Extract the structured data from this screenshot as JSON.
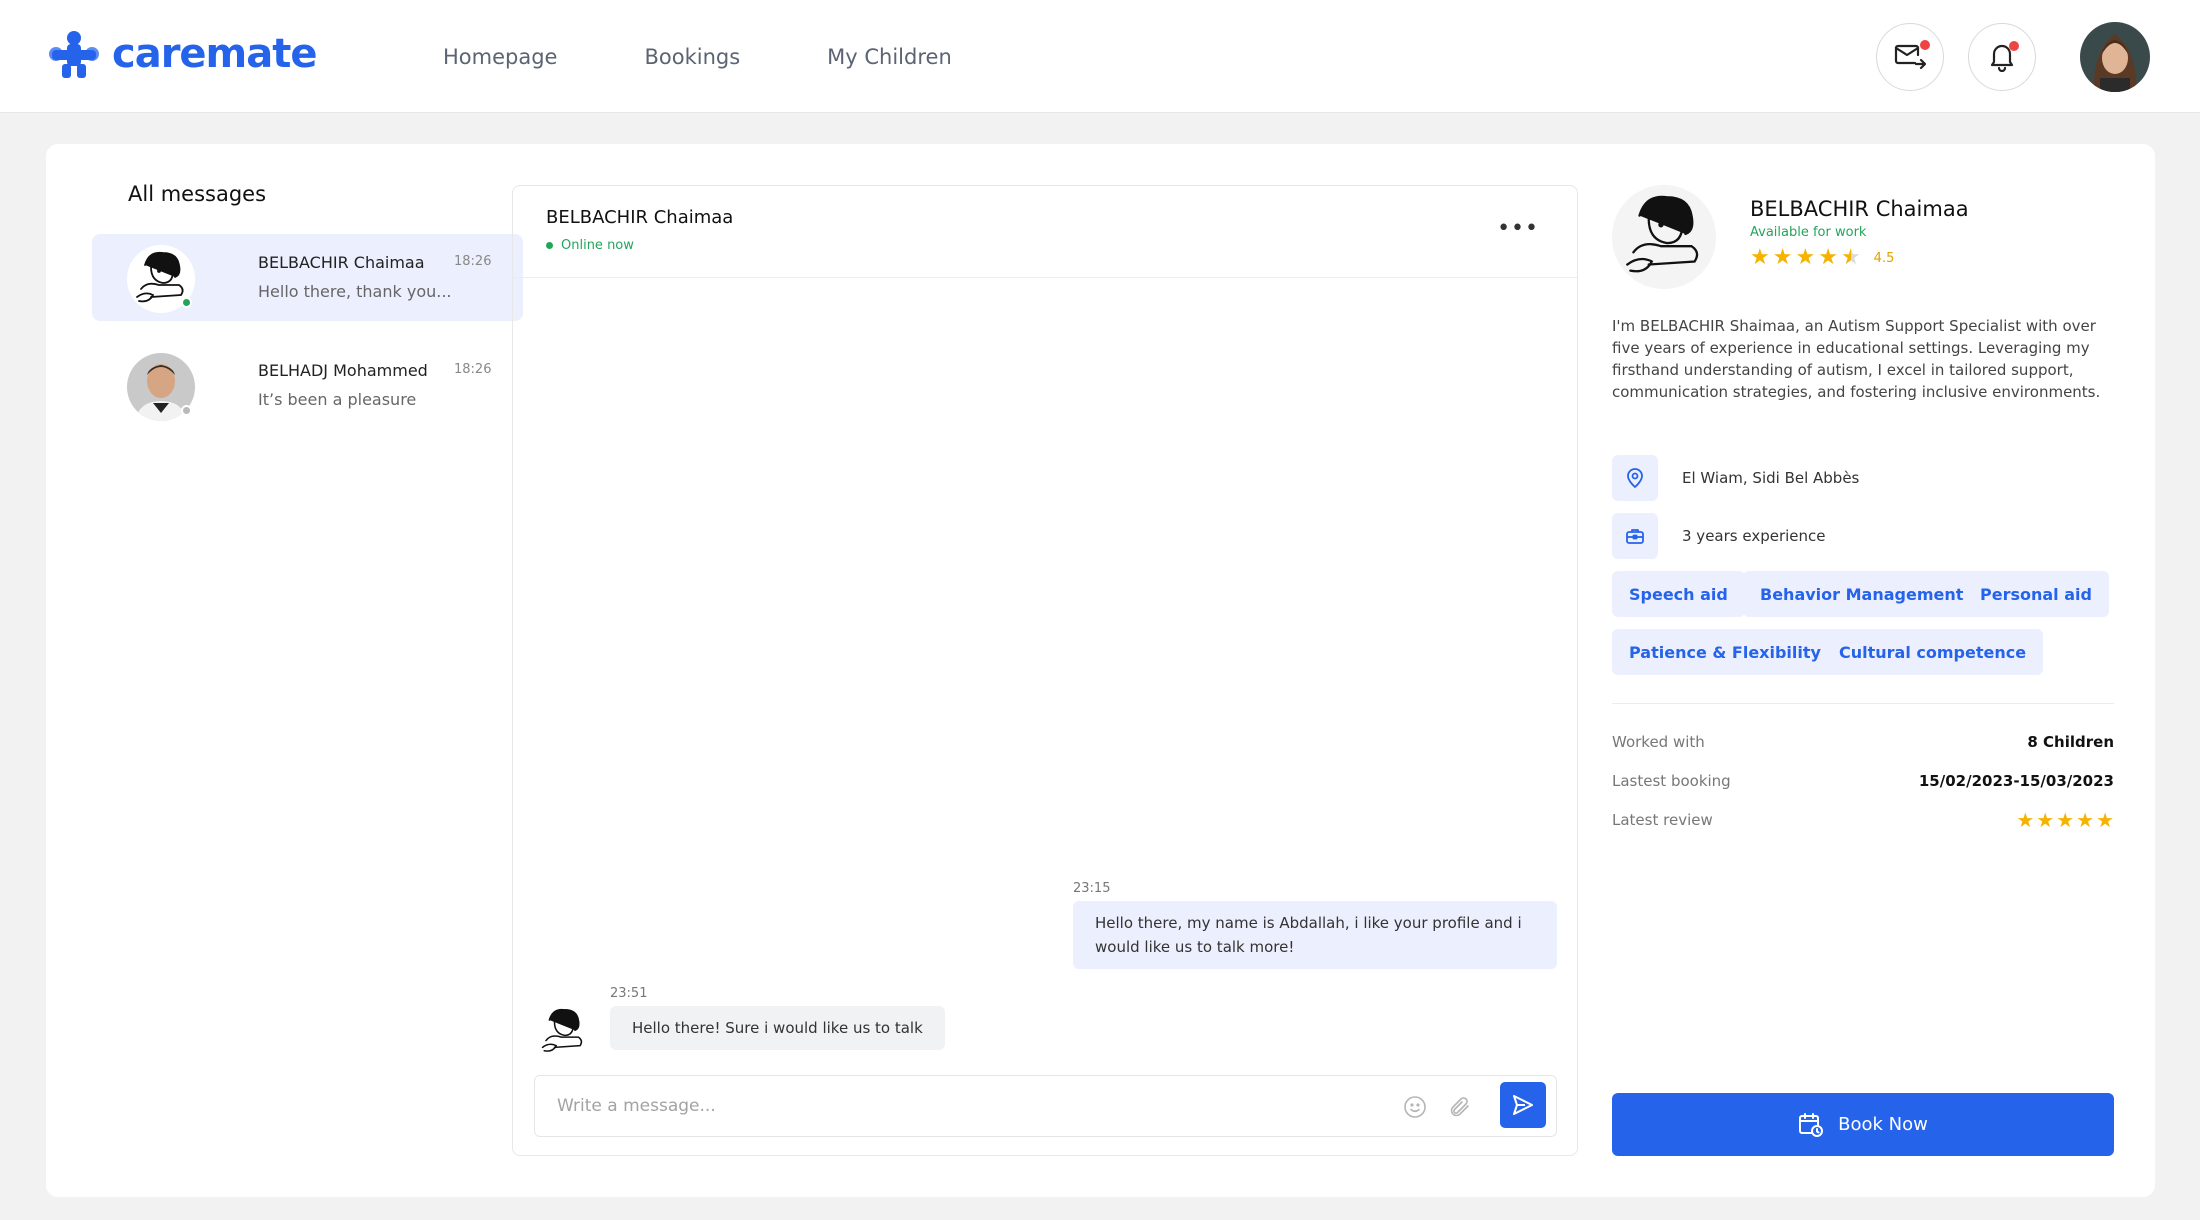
{
  "app": {
    "brand": "caremate"
  },
  "nav": {
    "items": [
      "Homepage",
      "Bookings",
      "My Children"
    ]
  },
  "colors": {
    "accent": "#2563eb",
    "online": "#22a55b",
    "star": "#f5b300",
    "notify": "#ef4444"
  },
  "messages": {
    "title": "All messages",
    "conversations": [
      {
        "name": "BELBACHIR Chaimaa",
        "time": "18:26",
        "preview": "Hello there, thank you...",
        "status": "online"
      },
      {
        "name": "BELHADJ Mohammed",
        "time": "18:26",
        "preview": "It’s been a pleasure",
        "status": "offline"
      }
    ]
  },
  "chat": {
    "name": "BELBACHIR Chaimaa",
    "status": "Online now",
    "messages": [
      {
        "time": "23:15",
        "text": "Hello there, my name is Abdallah, i like your profile and i would like us to talk more!",
        "direction": "outgoing"
      },
      {
        "time": "23:51",
        "text": "Hello there! Sure i would like us to talk",
        "direction": "incoming"
      }
    ],
    "composer": {
      "placeholder": "Write a message..."
    }
  },
  "profile": {
    "name": "BELBACHIR Chaimaa",
    "availability": "Available for work",
    "rating": "4.5",
    "bio": "I'm BELBACHIR Shaimaa, an Autism Support Specialist with over five years of experience in educational settings. Leveraging my firsthand understanding of autism, I excel in tailored support, communication strategies, and fostering inclusive environments.",
    "location": "El Wiam, Sidi Bel Abbès",
    "experience": "3 years experience",
    "tags": [
      "Speech aid",
      "Behavior Management",
      "Personal aid",
      "Patience & Flexibility",
      "Cultural competence"
    ],
    "stats": {
      "worked_with_label": "Worked with",
      "worked_with": "8 Children",
      "latest_booking_label": "Lastest booking",
      "latest_booking": "15/02/2023-15/03/2023",
      "latest_review_label": "Latest review",
      "latest_review_stars": 5
    },
    "book_label": "Book Now"
  }
}
